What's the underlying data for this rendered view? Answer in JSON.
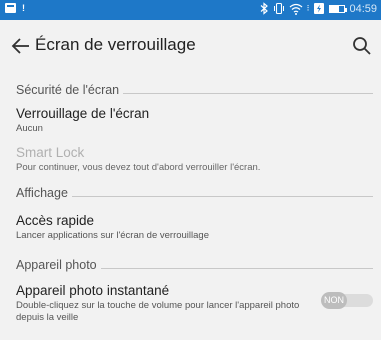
{
  "status_bar": {
    "time": "04:59",
    "battery_level": 0.6,
    "icons": [
      "notification-box-icon",
      "notification-exclamation-icon",
      "bluetooth-icon",
      "vibrate-icon",
      "wifi-icon",
      "charging-icon",
      "battery-icon"
    ]
  },
  "header": {
    "title": "Écran de verrouillage",
    "back_icon": "arrow-left-icon",
    "search_icon": "search-icon"
  },
  "sections": {
    "screen_security": {
      "label": "Sécurité de l'écran",
      "lock": {
        "title": "Verrouillage de l'écran",
        "summary": "Aucun"
      },
      "smart_lock": {
        "title": "Smart Lock",
        "summary": "Pour continuer, vous devez tout d'abord verrouiller l'écran."
      }
    },
    "display": {
      "label": "Affichage",
      "quick_access": {
        "title": "Accès rapide",
        "summary": "Lancer applications sur l'écran de verrouillage"
      }
    },
    "camera": {
      "label": "Appareil photo",
      "instant_camera": {
        "title": "Appareil photo instantané",
        "summary": "Double-cliquez sur la touche de volume pour lancer l'appareil photo depuis la veille",
        "toggle_label": "NON"
      }
    }
  },
  "colors": {
    "status_bar": "#1e78c8",
    "background": "#f2f2f2",
    "disabled_text": "#b0b0b0",
    "toggle_off": "#bdbdbd"
  }
}
